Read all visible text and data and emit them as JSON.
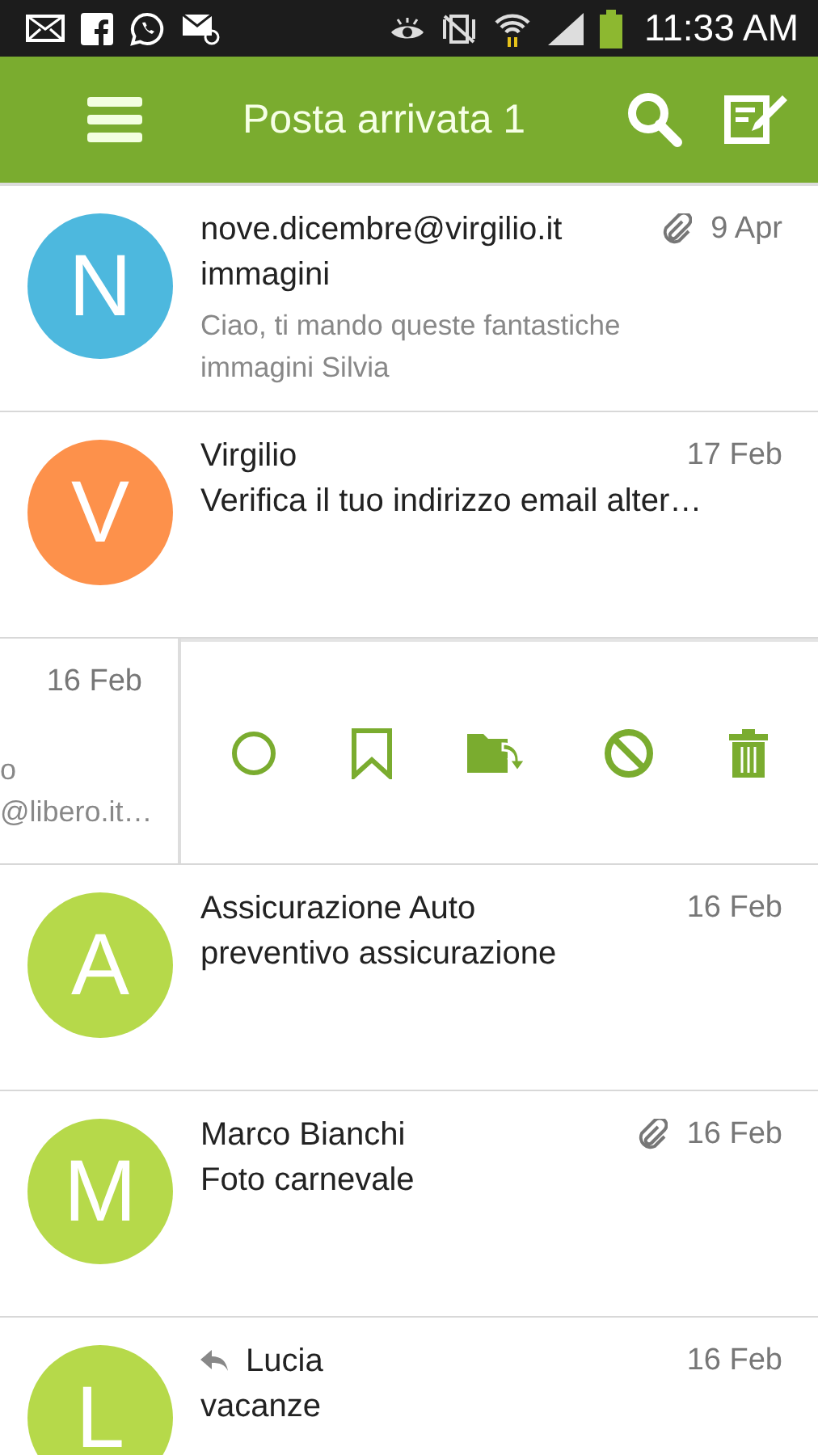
{
  "status_bar": {
    "time": "11:33 AM"
  },
  "app_bar": {
    "title": "Posta arrivata 1"
  },
  "messages": [
    {
      "kind": "message",
      "initial": "N",
      "color": "#4db8de",
      "sender": "nove.dicembre@virgilio.it",
      "date": "9 Apr",
      "attachment": true,
      "replied": false,
      "subject": "immagini",
      "preview": "Ciao, ti mando queste fantastiche immagini Silvia"
    },
    {
      "kind": "message",
      "initial": "V",
      "color": "#fd914b",
      "sender": "Virgilio",
      "date": "17 Feb",
      "attachment": false,
      "replied": false,
      "subject": "Verifica il tuo indirizzo email alter…"
    },
    {
      "kind": "swiped",
      "date": "16 Feb",
      "line_1": "o",
      "line_2": "@libero.it…"
    },
    {
      "kind": "message",
      "initial": "A",
      "color": "#b6d94a",
      "sender": "Assicurazione Auto",
      "date": "16 Feb",
      "attachment": false,
      "replied": false,
      "subject": "preventivo assicurazione"
    },
    {
      "kind": "message",
      "initial": "M",
      "color": "#b6d94a",
      "sender": "Marco Bianchi",
      "date": "16 Feb",
      "attachment": true,
      "replied": false,
      "subject": "Foto carnevale"
    },
    {
      "kind": "message",
      "initial": "L",
      "color": "#b6d94a",
      "sender": "Lucia",
      "date": "16 Feb",
      "attachment": false,
      "replied": true,
      "subject": "vacanze"
    }
  ]
}
